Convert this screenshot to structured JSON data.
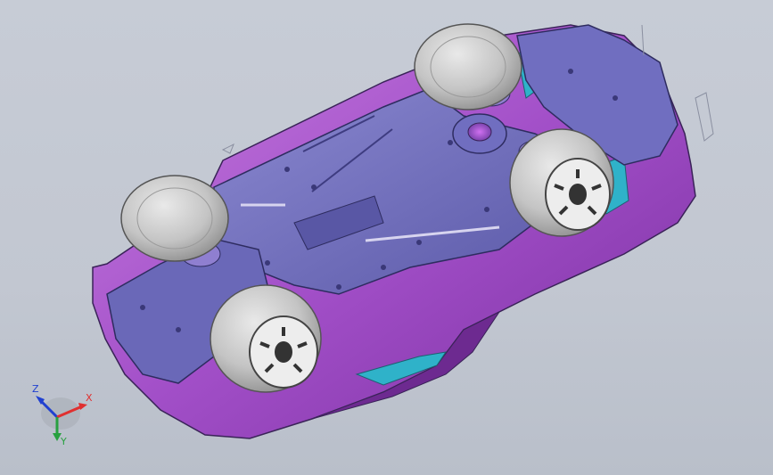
{
  "viewport": {
    "background_top": "#c7ccd6",
    "background_bottom": "#b9bfca"
  },
  "model": {
    "body_color": "#a24fc8",
    "chassis_color": "#6a68b8",
    "accent_color": "#2fb2c9",
    "tire_color": "#c9c9c9",
    "rim_color": "#f2f2f2"
  },
  "triad": {
    "x_label": "X",
    "y_label": "Y",
    "z_label": "Z",
    "x_color": "#e03030",
    "y_color": "#28a040",
    "z_color": "#2040d0"
  }
}
